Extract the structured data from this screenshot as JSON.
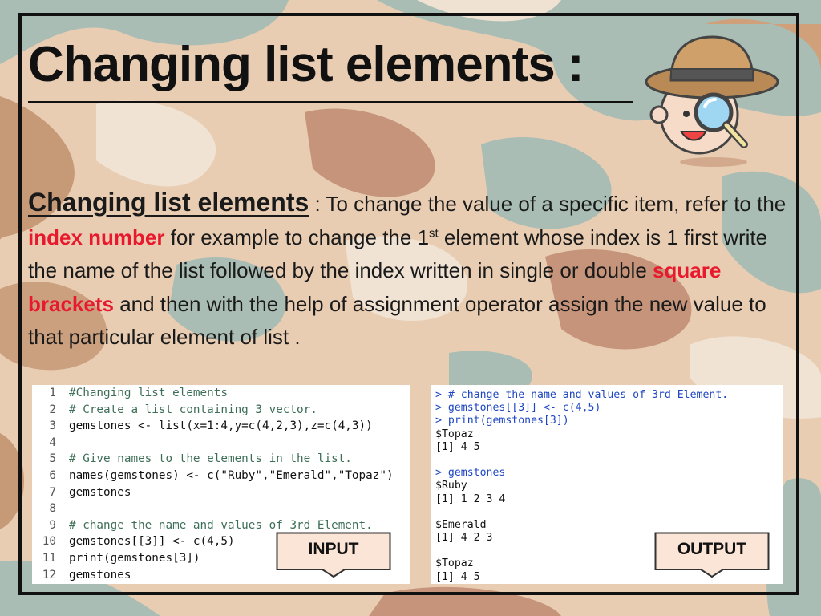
{
  "title": "Changing list elements :",
  "body": {
    "subheading": "Changing list elements",
    "p1": " : To change the value of a specific item, refer to the ",
    "hl1": "index number",
    "p2": " for example to change the  1",
    "sup": "st",
    "p3": " element whose index is 1 first write the name of the list followed by the index written in single or double ",
    "hl2": "square brackets",
    "p4": " and then with the help of assignment operator assign the new value to that particular element of list ."
  },
  "input_code": [
    "#Changing list elements",
    "# Create a list containing 3 vector.",
    "gemstones <- list(x=1:4,y=c(4,2,3),z=c(4,3))",
    "",
    "# Give names to the elements in the list.",
    "names(gemstones) <- c(\"Ruby\",\"Emerald\",\"Topaz\")",
    "gemstones",
    "",
    "# change the name and values of 3rd Element.",
    "gemstones[[3]] <- c(4,5)",
    "print(gemstones[3])",
    "gemstones"
  ],
  "output_lines": [
    "> # change the name and values of 3rd Element.",
    "> gemstones[[3]] <- c(4,5)",
    "> print(gemstones[3])",
    "$Topaz",
    "[1] 4 5",
    "",
    "> gemstones",
    "$Ruby",
    "[1] 1 2 3 4",
    "",
    "$Emerald",
    "[1] 4 2 3",
    "",
    "$Topaz",
    "[1] 4 5"
  ],
  "callouts": {
    "input": "INPUT",
    "output": "OUTPUT"
  },
  "icons": {
    "illustration": "detective-magnifier-icon"
  },
  "colors": {
    "highlight": "#e8192c",
    "code_comment": "#3d6e57",
    "console_command": "#1f47c2"
  }
}
